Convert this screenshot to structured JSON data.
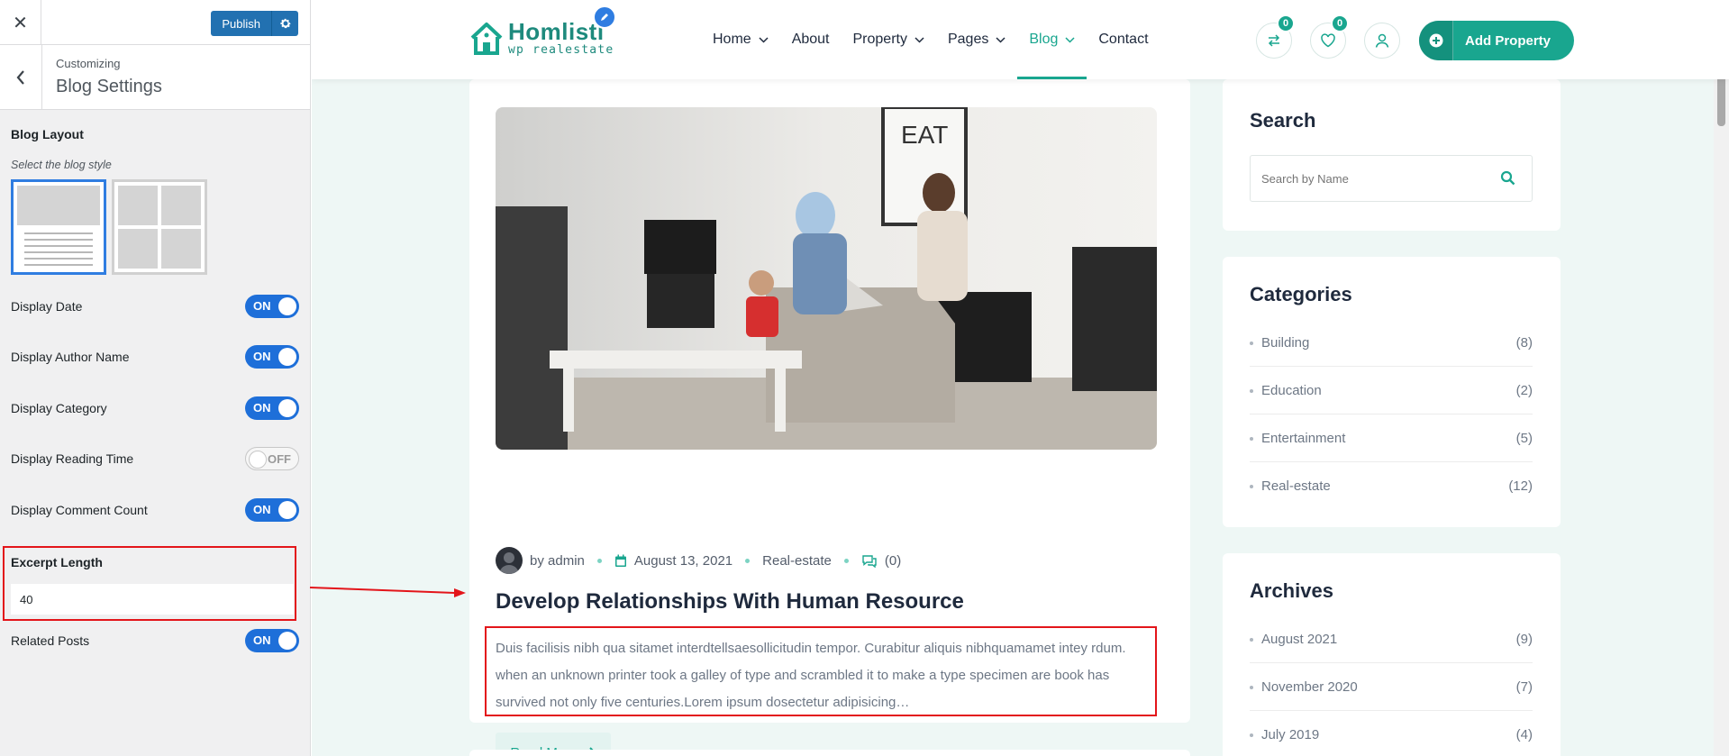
{
  "customizer": {
    "close_icon": "close-icon",
    "publish_label": "Publish",
    "crumb": "Customizing",
    "title": "Blog Settings",
    "layout_label": "Blog Layout",
    "layout_desc": "Select the blog style",
    "toggles": [
      {
        "label": "Display Date",
        "state": "ON"
      },
      {
        "label": "Display Author Name",
        "state": "ON"
      },
      {
        "label": "Display Category",
        "state": "ON"
      },
      {
        "label": "Display Reading Time",
        "state": "OFF"
      },
      {
        "label": "Display Comment Count",
        "state": "ON"
      }
    ],
    "excerpt_label": "Excerpt Length",
    "excerpt_value": "40",
    "related_label": "Related Posts",
    "related_state": "ON"
  },
  "site": {
    "logo_name": "Homlisti",
    "logo_tag": "wp realestate",
    "nav": [
      {
        "label": "Home",
        "has_menu": true
      },
      {
        "label": "About",
        "has_menu": false
      },
      {
        "label": "Property",
        "has_menu": true
      },
      {
        "label": "Pages",
        "has_menu": true
      },
      {
        "label": "Blog",
        "has_menu": true,
        "active": true
      },
      {
        "label": "Contact",
        "has_menu": false
      }
    ],
    "compare_count": "0",
    "favorite_count": "0",
    "add_property": "Add Property",
    "accent_color": "#19a68f"
  },
  "post": {
    "author": "by admin",
    "date": "August 13, 2021",
    "category": "Real-estate",
    "comments": "(0)",
    "title": "Develop Relationships With Human Resource",
    "excerpt": "Duis facilisis nibh qua sitamet interdtellsaesollicitudin tempor. Curabitur aliquis nibhquamamet intey rdum. when an unknown printer took a galley of type and scrambled it to make a type specimen are book has survived not only five centuries.Lorem ipsum dosectetur adipisicing…",
    "read_more": "Read More"
  },
  "sidebar": {
    "search_title": "Search",
    "search_placeholder": "Search by Name",
    "categories_title": "Categories",
    "categories": [
      {
        "name": "Building",
        "count": "(8)"
      },
      {
        "name": "Education",
        "count": "(2)"
      },
      {
        "name": "Entertainment",
        "count": "(5)"
      },
      {
        "name": "Real-estate",
        "count": "(12)"
      }
    ],
    "archives_title": "Archives",
    "archives": [
      {
        "name": "August 2021",
        "count": "(9)"
      },
      {
        "name": "November 2020",
        "count": "(7)"
      },
      {
        "name": "July 2019",
        "count": "(4)"
      }
    ]
  }
}
